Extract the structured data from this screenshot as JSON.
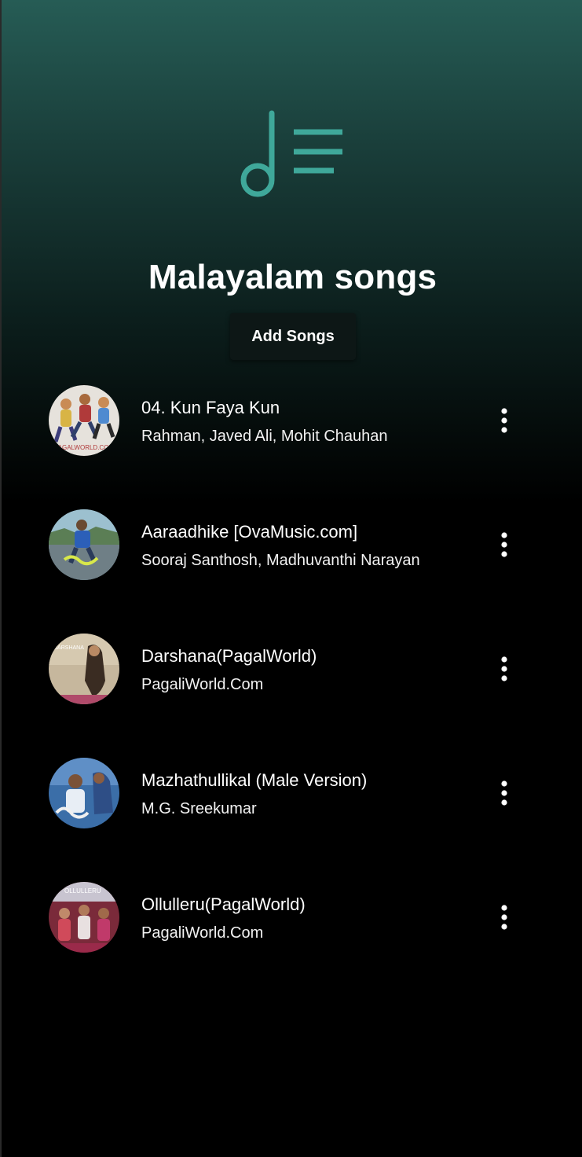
{
  "playlist": {
    "title": "Malayalam songs",
    "icon": "music-playlist-icon",
    "accent_color": "#3fa89a",
    "add_button_label": "Add Songs"
  },
  "songs": [
    {
      "title": "04. Kun Faya Kun",
      "artist": "Rahman, Javed Ali, Mohit Chauhan",
      "art_text": "PAGALWORLD.COM"
    },
    {
      "title": "Aaraadhike [OvaMusic.com]",
      "artist": "Sooraj Santhosh, Madhuvanthi Narayan",
      "art_text": ""
    },
    {
      "title": "Darshana(PagalWorld)",
      "artist": "PagaliWorld.Com",
      "art_text": "DARSHANA"
    },
    {
      "title": "Mazhathullikal (Male Version)",
      "artist": "M.G. Sreekumar",
      "art_text": ""
    },
    {
      "title": "Ollulleru(PagalWorld)",
      "artist": "PagaliWorld.Com",
      "art_text": "OLLULLERU"
    }
  ],
  "row_icons": {
    "more": "more-vertical-icon"
  }
}
